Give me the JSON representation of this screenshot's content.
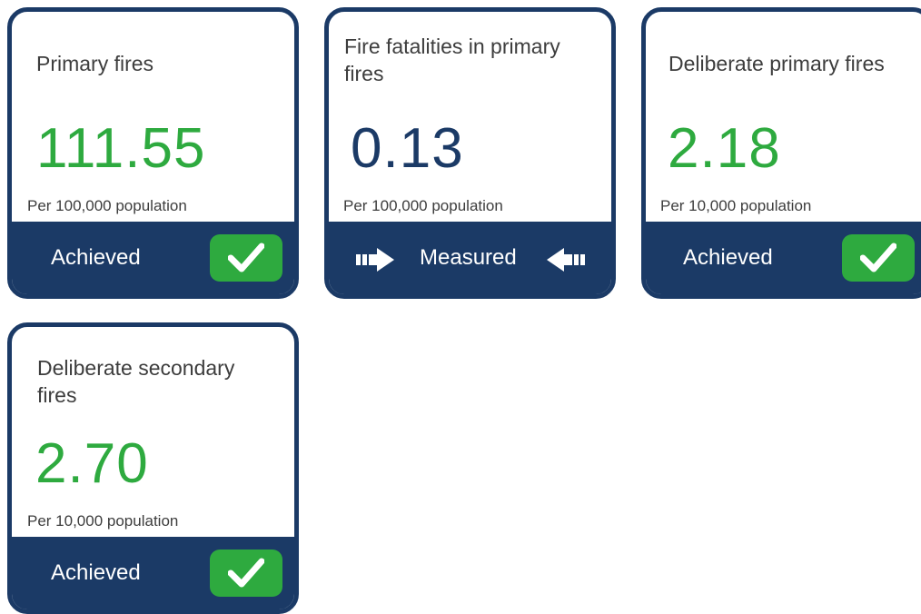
{
  "cards": [
    {
      "title": "Primary fires",
      "value": "111.55",
      "unit": "Per 100,000 population",
      "status": "Achieved",
      "status_icon": "check-icon"
    },
    {
      "title": "Fire fatalities in primary fires",
      "value": "0.13",
      "unit": "Per 100,000 population",
      "status": "Measured",
      "status_icon": "arrow-in-icons"
    },
    {
      "title": "Deliberate primary fires",
      "value": "2.18",
      "unit": "Per 10,000 population",
      "status": "Achieved",
      "status_icon": "check-icon"
    },
    {
      "title": "Deliberate secondary fires",
      "value": "2.70",
      "unit": "Per 10,000 population",
      "status": "Achieved",
      "status_icon": "check-icon"
    }
  ],
  "colors": {
    "navy": "#1b3a66",
    "green": "#2eaa3f",
    "text": "#3d3d3d"
  }
}
